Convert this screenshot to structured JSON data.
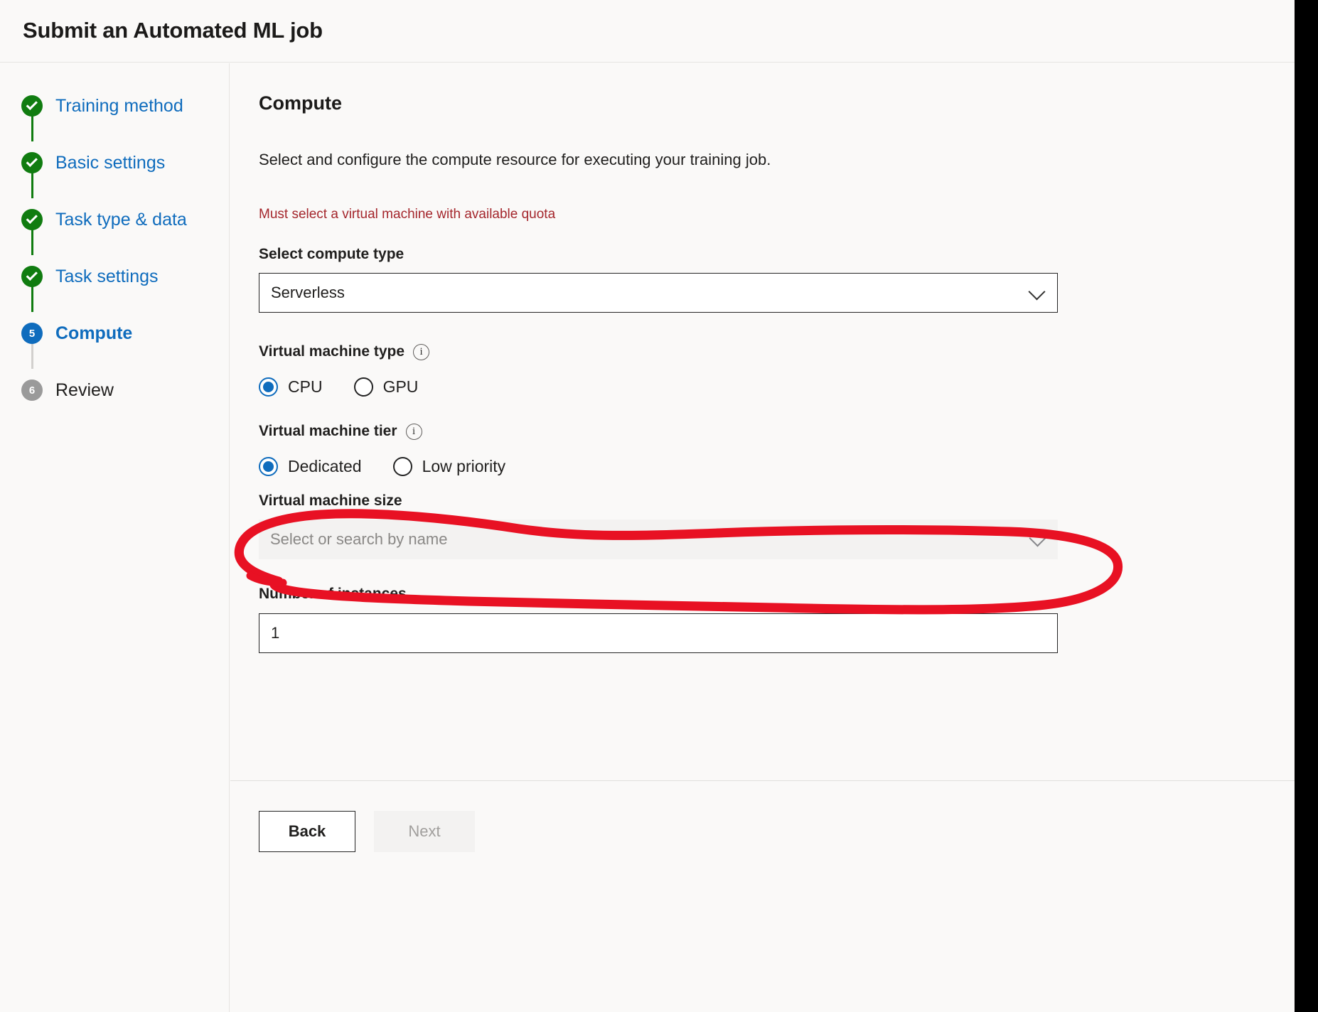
{
  "window": {
    "title": "Submit an Automated ML job"
  },
  "sidebar": {
    "steps": [
      {
        "label": "Training method",
        "marker": "check",
        "state": "done"
      },
      {
        "label": "Basic settings",
        "marker": "check",
        "state": "done"
      },
      {
        "label": "Task type & data",
        "marker": "check",
        "state": "done"
      },
      {
        "label": "Task settings",
        "marker": "check",
        "state": "done"
      },
      {
        "label": "Compute",
        "marker": "5",
        "state": "current"
      },
      {
        "label": "Review",
        "marker": "6",
        "state": "todo"
      }
    ]
  },
  "main": {
    "heading": "Compute",
    "description": "Select and configure the compute resource for executing your training job.",
    "error_message": "Must select a virtual machine with available quota",
    "compute_type": {
      "label": "Select compute type",
      "value": "Serverless"
    },
    "vm_type": {
      "label": "Virtual machine type",
      "info_glyph": "i",
      "options": [
        {
          "label": "CPU",
          "selected": true
        },
        {
          "label": "GPU",
          "selected": false
        }
      ]
    },
    "vm_tier": {
      "label": "Virtual machine tier",
      "info_glyph": "i",
      "options": [
        {
          "label": "Dedicated",
          "selected": true
        },
        {
          "label": "Low priority",
          "selected": false
        }
      ]
    },
    "vm_size": {
      "label": "Virtual machine size",
      "placeholder": "Select or search by name",
      "value": "",
      "disabled": true
    },
    "instances": {
      "label": "Number of instances",
      "value": "1"
    }
  },
  "footer": {
    "back_label": "Back",
    "next_label": "Next"
  },
  "annotation": {
    "shape": "hand-drawn-ellipse",
    "color": "#e81123",
    "target": "Virtual machine size"
  },
  "colors": {
    "accent_blue": "#0f6cbd",
    "success_green": "#107c10",
    "error_red": "#a4262c",
    "annotation_red": "#e81123",
    "page_background": "#faf9f8"
  }
}
